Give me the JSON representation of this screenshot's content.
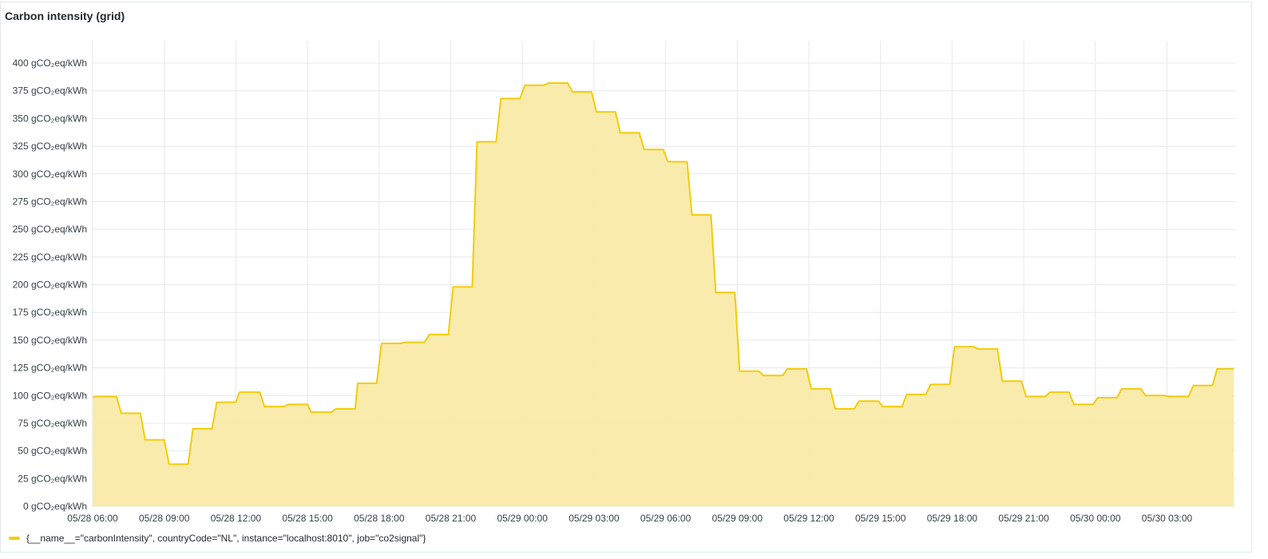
{
  "panel": {
    "title": "Carbon intensity (grid)"
  },
  "colors": {
    "series_line": "#F2CC0C",
    "series_fill": "#F9EAA6",
    "grid": "#e6e8eb",
    "axis_text": "#3a3f45"
  },
  "chart_data": {
    "type": "area",
    "title": "Carbon intensity (grid)",
    "x_unit": "hours since 05/28 06:00",
    "ylim": [
      0,
      400
    ],
    "xlim": [
      0,
      47.8
    ],
    "grid": true,
    "legend_position": "bottom-left",
    "y_ticks": [
      {
        "v": 0,
        "label": "0 gCO₂eq/kWh"
      },
      {
        "v": 25,
        "label": "25 gCO₂eq/kWh"
      },
      {
        "v": 50,
        "label": "50 gCO₂eq/kWh"
      },
      {
        "v": 75,
        "label": "75 gCO₂eq/kWh"
      },
      {
        "v": 100,
        "label": "100 gCO₂eq/kWh"
      },
      {
        "v": 125,
        "label": "125 gCO₂eq/kWh"
      },
      {
        "v": 150,
        "label": "150 gCO₂eq/kWh"
      },
      {
        "v": 175,
        "label": "175 gCO₂eq/kWh"
      },
      {
        "v": 200,
        "label": "200 gCO₂eq/kWh"
      },
      {
        "v": 225,
        "label": "225 gCO₂eq/kWh"
      },
      {
        "v": 250,
        "label": "250 gCO₂eq/kWh"
      },
      {
        "v": 275,
        "label": "275 gCO₂eq/kWh"
      },
      {
        "v": 300,
        "label": "300 gCO₂eq/kWh"
      },
      {
        "v": 325,
        "label": "325 gCO₂eq/kWh"
      },
      {
        "v": 350,
        "label": "350 gCO₂eq/kWh"
      },
      {
        "v": 375,
        "label": "375 gCO₂eq/kWh"
      },
      {
        "v": 400,
        "label": "400 gCO₂eq/kWh"
      }
    ],
    "x_ticks": [
      {
        "h": 0,
        "label": "05/28 06:00"
      },
      {
        "h": 3,
        "label": "05/28 09:00"
      },
      {
        "h": 6,
        "label": "05/28 12:00"
      },
      {
        "h": 9,
        "label": "05/28 15:00"
      },
      {
        "h": 12,
        "label": "05/28 18:00"
      },
      {
        "h": 15,
        "label": "05/28 21:00"
      },
      {
        "h": 18,
        "label": "05/29 00:00"
      },
      {
        "h": 21,
        "label": "05/29 03:00"
      },
      {
        "h": 24,
        "label": "05/29 06:00"
      },
      {
        "h": 27,
        "label": "05/29 09:00"
      },
      {
        "h": 30,
        "label": "05/29 12:00"
      },
      {
        "h": 33,
        "label": "05/29 15:00"
      },
      {
        "h": 36,
        "label": "05/29 18:00"
      },
      {
        "h": 39,
        "label": "05/29 21:00"
      },
      {
        "h": 42,
        "label": "05/30 00:00"
      },
      {
        "h": 45,
        "label": "05/30 03:00"
      }
    ],
    "series": [
      {
        "name": "{__name__=\"carbonIntensity\", countryCode=\"NL\", instance=\"localhost:8010\", job=\"co2signal\"}",
        "points": [
          [
            0.0,
            98
          ],
          [
            0.1,
            99
          ],
          [
            1.0,
            99
          ],
          [
            1.2,
            84
          ],
          [
            2.0,
            84
          ],
          [
            2.2,
            60
          ],
          [
            3.0,
            60
          ],
          [
            3.2,
            38
          ],
          [
            4.0,
            38
          ],
          [
            4.2,
            70
          ],
          [
            5.0,
            70
          ],
          [
            5.2,
            94
          ],
          [
            6.0,
            94
          ],
          [
            6.15,
            103
          ],
          [
            7.0,
            103
          ],
          [
            7.2,
            90
          ],
          [
            8.0,
            90
          ],
          [
            8.2,
            92
          ],
          [
            9.0,
            92
          ],
          [
            9.15,
            85
          ],
          [
            10.0,
            85
          ],
          [
            10.2,
            88
          ],
          [
            11.0,
            88
          ],
          [
            11.1,
            111
          ],
          [
            11.9,
            111
          ],
          [
            12.1,
            147
          ],
          [
            12.9,
            147
          ],
          [
            13.1,
            148
          ],
          [
            13.9,
            148
          ],
          [
            14.1,
            155
          ],
          [
            14.9,
            155
          ],
          [
            15.1,
            198
          ],
          [
            15.9,
            198
          ],
          [
            16.1,
            329
          ],
          [
            16.9,
            329
          ],
          [
            17.1,
            368
          ],
          [
            17.9,
            368
          ],
          [
            18.1,
            380
          ],
          [
            18.9,
            380
          ],
          [
            19.1,
            382
          ],
          [
            19.9,
            382
          ],
          [
            20.1,
            374
          ],
          [
            20.9,
            374
          ],
          [
            21.1,
            356
          ],
          [
            21.9,
            356
          ],
          [
            22.1,
            337
          ],
          [
            22.9,
            337
          ],
          [
            23.1,
            322
          ],
          [
            23.9,
            322
          ],
          [
            24.1,
            311
          ],
          [
            24.9,
            311
          ],
          [
            25.1,
            263
          ],
          [
            25.9,
            263
          ],
          [
            26.1,
            193
          ],
          [
            26.9,
            193
          ],
          [
            27.1,
            122
          ],
          [
            27.9,
            122
          ],
          [
            28.1,
            118
          ],
          [
            28.9,
            118
          ],
          [
            29.1,
            124
          ],
          [
            29.9,
            124
          ],
          [
            30.1,
            106
          ],
          [
            30.9,
            106
          ],
          [
            31.1,
            88
          ],
          [
            31.9,
            88
          ],
          [
            32.1,
            95
          ],
          [
            32.9,
            95
          ],
          [
            33.1,
            90
          ],
          [
            33.9,
            90
          ],
          [
            34.1,
            101
          ],
          [
            34.9,
            101
          ],
          [
            35.1,
            110
          ],
          [
            35.9,
            110
          ],
          [
            36.1,
            144
          ],
          [
            36.9,
            144
          ],
          [
            37.1,
            142
          ],
          [
            37.9,
            142
          ],
          [
            38.1,
            113
          ],
          [
            38.9,
            113
          ],
          [
            39.1,
            99
          ],
          [
            39.9,
            99
          ],
          [
            40.1,
            103
          ],
          [
            40.9,
            103
          ],
          [
            41.1,
            92
          ],
          [
            41.9,
            92
          ],
          [
            42.1,
            98
          ],
          [
            42.9,
            98
          ],
          [
            43.1,
            106
          ],
          [
            43.9,
            106
          ],
          [
            44.1,
            100
          ],
          [
            44.9,
            100
          ],
          [
            45.1,
            99
          ],
          [
            45.9,
            99
          ],
          [
            46.1,
            109
          ],
          [
            46.9,
            109
          ],
          [
            47.1,
            124
          ],
          [
            47.8,
            124
          ]
        ]
      }
    ]
  }
}
